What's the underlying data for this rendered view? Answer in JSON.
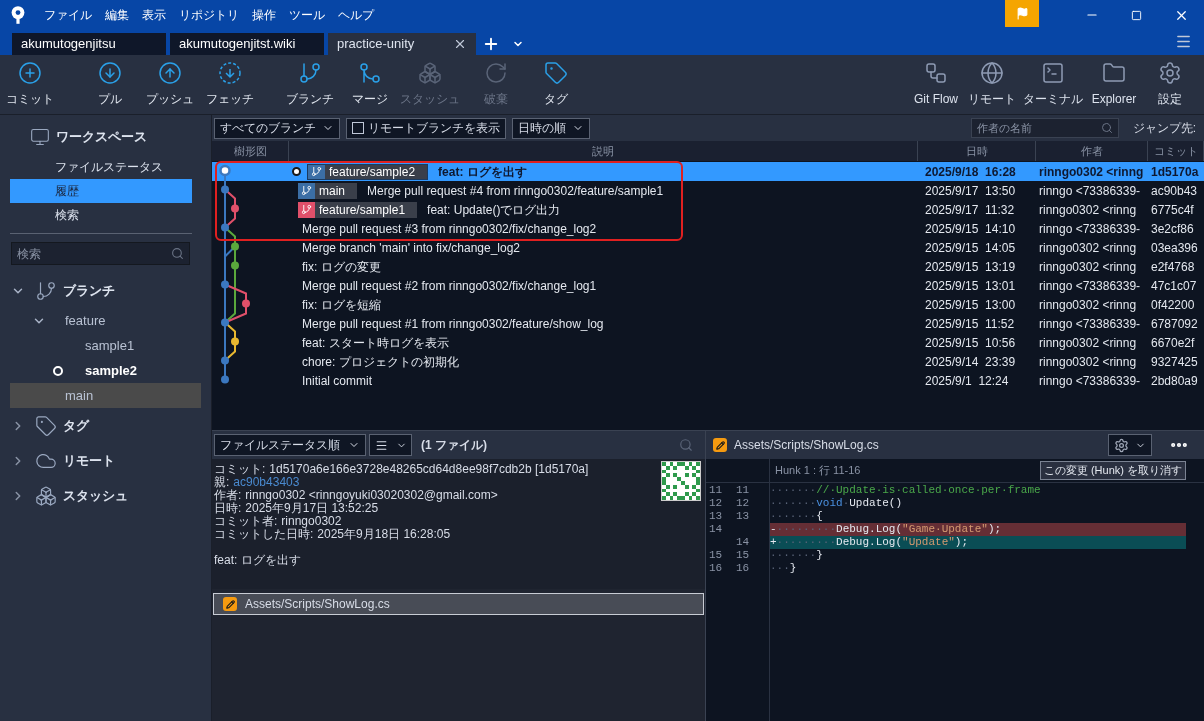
{
  "window": {
    "menu": [
      "ファイル",
      "編集",
      "表示",
      "リポジトリ",
      "操作",
      "ツール",
      "ヘルプ"
    ]
  },
  "tabs": [
    {
      "label": "akumutogenjitsu",
      "selected": false
    },
    {
      "label": "akumutogenjitst.wiki",
      "selected": false
    },
    {
      "label": "practice-unity",
      "selected": true
    }
  ],
  "toolbar": [
    {
      "label": "コミット",
      "kind": "commit",
      "disabled": false
    },
    {
      "label": "プル",
      "kind": "pull",
      "disabled": false
    },
    {
      "label": "プッシュ",
      "kind": "push",
      "disabled": false
    },
    {
      "label": "フェッチ",
      "kind": "fetch",
      "disabled": false
    },
    {
      "label": "ブランチ",
      "kind": "branch",
      "disabled": false
    },
    {
      "label": "マージ",
      "kind": "merge",
      "disabled": false
    },
    {
      "label": "スタッシュ",
      "kind": "stash",
      "disabled": true
    },
    {
      "label": "破棄",
      "kind": "discard",
      "disabled": true
    },
    {
      "label": "タグ",
      "kind": "tag",
      "disabled": false
    }
  ],
  "toolbar_right": [
    {
      "label": "Git Flow",
      "kind": "gitflow"
    },
    {
      "label": "リモート",
      "kind": "remote"
    },
    {
      "label": "ターミナル",
      "kind": "terminal"
    },
    {
      "label": "Explorer",
      "kind": "explorer"
    },
    {
      "label": "設定",
      "kind": "settings"
    }
  ],
  "sidebar": {
    "workspace": "ワークスペース",
    "items": [
      {
        "label": "ファイルステータス",
        "selected": false
      },
      {
        "label": "履歴",
        "selected": true
      },
      {
        "label": "検索",
        "selected": false
      }
    ],
    "search": {
      "placeholder": "検索"
    },
    "sections": [
      {
        "label": "ブランチ",
        "kind": "branch",
        "expanded": true,
        "children": [
          {
            "label": "feature",
            "expanded": true,
            "children": [
              {
                "label": "sample1",
                "current": false,
                "selected": false
              },
              {
                "label": "sample2",
                "current": true,
                "selected": false
              }
            ]
          },
          {
            "label": "main",
            "current": false,
            "selected": true
          }
        ]
      },
      {
        "label": "タグ",
        "kind": "tag",
        "expanded": false
      },
      {
        "label": "リモート",
        "kind": "remote",
        "expanded": false
      },
      {
        "label": "スタッシュ",
        "kind": "stash",
        "expanded": false
      }
    ]
  },
  "filter": {
    "branches": "すべてのブランチ",
    "show_remote": {
      "label": "リモートブランチを表示",
      "checked": false
    },
    "order": "日時の順",
    "author_search": {
      "placeholder": "作者の名前"
    },
    "jump": "ジャンプ先:"
  },
  "table": {
    "columns": [
      "樹形図",
      "説明",
      "日時",
      "作者",
      "コミット"
    ],
    "rows": [
      {
        "head": true,
        "refs": [
          {
            "label": "feature/sample2",
            "color": "#3b6ea5"
          }
        ],
        "description": "feat: ログを出す",
        "date": "2025/9/18  16:28",
        "author": "rinngo0302 <rinng",
        "commit": "1d5170a",
        "selected": true
      },
      {
        "head": false,
        "refs": [
          {
            "label": "main",
            "color": "#3b6ea5"
          }
        ],
        "description": "Merge pull request #4 from rinngo0302/feature/sample1",
        "date": "2025/9/17  13:50",
        "author": "rinngo <73386339-",
        "commit": "ac90b43",
        "selected": false
      },
      {
        "head": false,
        "refs": [
          {
            "label": "feature/sample1",
            "color": "#e0506a"
          }
        ],
        "description": "feat: Update()でログ出力",
        "date": "2025/9/17  11:32",
        "author": "rinngo0302 <rinng",
        "commit": "6775c4f",
        "selected": false
      },
      {
        "head": false,
        "description": "Merge pull request #3 from rinngo0302/fix/change_log2",
        "date": "2025/9/15  14:10",
        "author": "rinngo <73386339-",
        "commit": "3e2cf86",
        "selected": false
      },
      {
        "head": false,
        "description": "Merge branch 'main' into fix/change_log2",
        "date": "2025/9/15  14:05",
        "author": "rinngo0302 <rinng",
        "commit": "03ea396",
        "selected": false
      },
      {
        "head": false,
        "description": "fix: ログの変更",
        "date": "2025/9/15  13:19",
        "author": "rinngo0302 <rinng",
        "commit": "e2f4768",
        "selected": false
      },
      {
        "head": false,
        "description": "Merge pull request #2 from rinngo0302/fix/change_log1",
        "date": "2025/9/15  13:01",
        "author": "rinngo <73386339-",
        "commit": "47c1c07",
        "selected": false
      },
      {
        "head": false,
        "description": "fix: ログを短縮",
        "date": "2025/9/15  13:00",
        "author": "rinngo0302 <rinng",
        "commit": "0f42200",
        "selected": false
      },
      {
        "head": false,
        "description": "Merge pull request #1 from rinngo0302/feature/show_log",
        "date": "2025/9/15  11:52",
        "author": "rinngo <73386339-",
        "commit": "6787092",
        "selected": false
      },
      {
        "head": false,
        "description": "feat: スタート時ログを表示",
        "date": "2025/9/15  10:56",
        "author": "rinngo0302 <rinng",
        "commit": "6670e2f",
        "selected": false
      },
      {
        "head": false,
        "description": "chore: プロジェクトの初期化",
        "date": "2025/9/14  23:39",
        "author": "rinngo0302 <rinng",
        "commit": "9327425",
        "selected": false
      },
      {
        "head": false,
        "description": "Initial commit",
        "date": "2025/9/1  12:24",
        "author": "rinngo <73386339-",
        "commit": "2bd80a9",
        "selected": false
      }
    ]
  },
  "details": {
    "sort": "ファイルステータス順",
    "file_count": "(1 ファイル)",
    "lines": [
      {
        "label": "コミット:",
        "value": "1d5170a6e166e3728e48265cd64d8ee98f7cdb2b [1d5170a]",
        "kind": "text"
      },
      {
        "label": "親:",
        "value": "ac90b43403",
        "kind": "link"
      },
      {
        "label": "作者:",
        "value": "rinngo0302 <rinngoyuki03020302@gmail.com>",
        "kind": "text"
      },
      {
        "label": "日時:",
        "value": "2025年9月17日 13:52:25",
        "kind": "text"
      },
      {
        "label": "コミット者:",
        "value": "rinngo0302",
        "kind": "text"
      },
      {
        "label": "コミットした日時:",
        "value": "2025年9月18日 16:28:05",
        "kind": "text"
      }
    ],
    "message": "feat: ログを出す",
    "files": [
      {
        "path": "Assets/Scripts/ShowLog.cs",
        "selected": true
      }
    ]
  },
  "diff": {
    "file": "Assets/Scripts/ShowLog.cs",
    "hunk": "Hunk 1 : 行 11-16",
    "discard_button": "この変更 (Hunk) を取り消す",
    "lines": [
      {
        "old": "11",
        "new": "11",
        "kind": "context",
        "segments": [
          {
            "text": "·······",
            "kind": "ws"
          },
          {
            "text": "//·Update·is·called·once·per·frame",
            "kind": "comment"
          }
        ]
      },
      {
        "old": "12",
        "new": "12",
        "kind": "context",
        "segments": [
          {
            "text": "·······",
            "kind": "ws"
          },
          {
            "text": "void",
            "kind": "keyword"
          },
          {
            "text": "·",
            "kind": "ws"
          },
          {
            "text": "Update()",
            "kind": "plain"
          }
        ]
      },
      {
        "old": "13",
        "new": "13",
        "kind": "context",
        "segments": [
          {
            "text": "·······",
            "kind": "ws"
          },
          {
            "text": "{",
            "kind": "plain"
          }
        ]
      },
      {
        "old": "14",
        "kind": "removed",
        "segments": [
          {
            "text": "-",
            "kind": "plain"
          },
          {
            "text": "·········",
            "kind": "ws"
          },
          {
            "text": "Debug.Log(",
            "kind": "plain"
          },
          {
            "text": "\"Game·Update\"",
            "kind": "string"
          },
          {
            "text": ");",
            "kind": "plain"
          }
        ]
      },
      {
        "new": "14",
        "kind": "added",
        "segments": [
          {
            "text": "+",
            "kind": "plain"
          },
          {
            "text": "·········",
            "kind": "ws"
          },
          {
            "text": "Debug.Log(",
            "kind": "plain"
          },
          {
            "text": "\"Update\"",
            "kind": "string"
          },
          {
            "text": ");",
            "kind": "plain"
          }
        ]
      },
      {
        "old": "15",
        "new": "15",
        "kind": "context",
        "segments": [
          {
            "text": "·······",
            "kind": "ws"
          },
          {
            "text": "}",
            "kind": "plain"
          }
        ]
      },
      {
        "old": "16",
        "new": "16",
        "kind": "context",
        "segments": [
          {
            "text": "···",
            "kind": "ws"
          },
          {
            "text": "}",
            "kind": "plain"
          }
        ]
      }
    ]
  }
}
